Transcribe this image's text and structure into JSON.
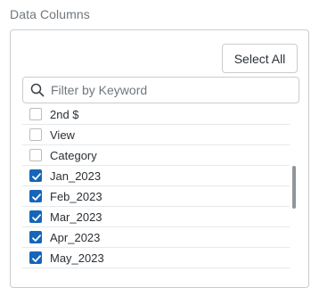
{
  "section": {
    "title": "Data Columns"
  },
  "toolbar": {
    "select_all_label": "Select All"
  },
  "filter": {
    "placeholder": "Filter by Keyword",
    "value": ""
  },
  "columns": [
    {
      "label": "2nd $",
      "checked": false
    },
    {
      "label": "View",
      "checked": false
    },
    {
      "label": "Category",
      "checked": false
    },
    {
      "label": "Jan_2023",
      "checked": true
    },
    {
      "label": "Feb_2023",
      "checked": true
    },
    {
      "label": "Mar_2023",
      "checked": true
    },
    {
      "label": "Apr_2023",
      "checked": true
    },
    {
      "label": "May_2023",
      "checked": true
    }
  ],
  "colors": {
    "accent": "#1466b8",
    "border": "#c9ccd0",
    "muted_text": "#6f777d"
  }
}
